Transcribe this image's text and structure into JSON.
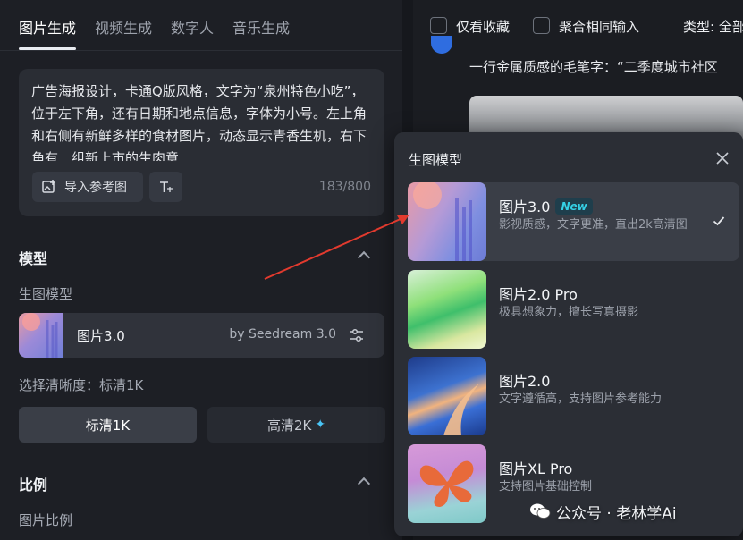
{
  "tabs": [
    "图片生成",
    "视频生成",
    "数字人",
    "音乐生成"
  ],
  "prompt": {
    "text": "广告海报设计，卡通Q版风格，文字为“泉州特色小吃”，位于左下角，还有日期和地点信息，字体为小号。左上角和右侧有新鲜多样的食材图片，动态显示青香生机，右下角有…组新上市的生肉意",
    "import_ref_label": "导入参考图",
    "counter": "183/800"
  },
  "model_section": {
    "title": "模型",
    "sub_label": "生图模型",
    "model_name": "图片3.0",
    "model_by": "by Seedream 3.0"
  },
  "resolution": {
    "label": "选择清晰度：标清1K",
    "options": [
      "标清1K",
      "高清2K"
    ]
  },
  "ratio_section": {
    "title": "比例",
    "sub_label": "图片比例"
  },
  "top_bar": {
    "favorites_only": "仅看收藏",
    "aggregate": "聚合相同输入",
    "type_label": "类型: 全部"
  },
  "feed": {
    "description": "一行金属质感的毛笔字：“二季度城市社区"
  },
  "popup": {
    "title": "生图模型",
    "options": [
      {
        "name": "图片3.0",
        "badge": "New",
        "desc": "影视质感，文字更准，直出2k高清图",
        "selected": true
      },
      {
        "name": "图片2.0 Pro",
        "desc": "极具想象力，擅长写真摄影"
      },
      {
        "name": "图片2.0",
        "desc": "文字遵循高，支持图片参考能力"
      },
      {
        "name": "图片XL Pro",
        "desc": "支持图片基础控制"
      }
    ]
  },
  "watermark": "公众号 · 老林学Ai",
  "colors": {
    "accent_new": "#35d0e6",
    "annotation_arrow": "#e23a2e",
    "sparkle": "#49c4f5"
  }
}
